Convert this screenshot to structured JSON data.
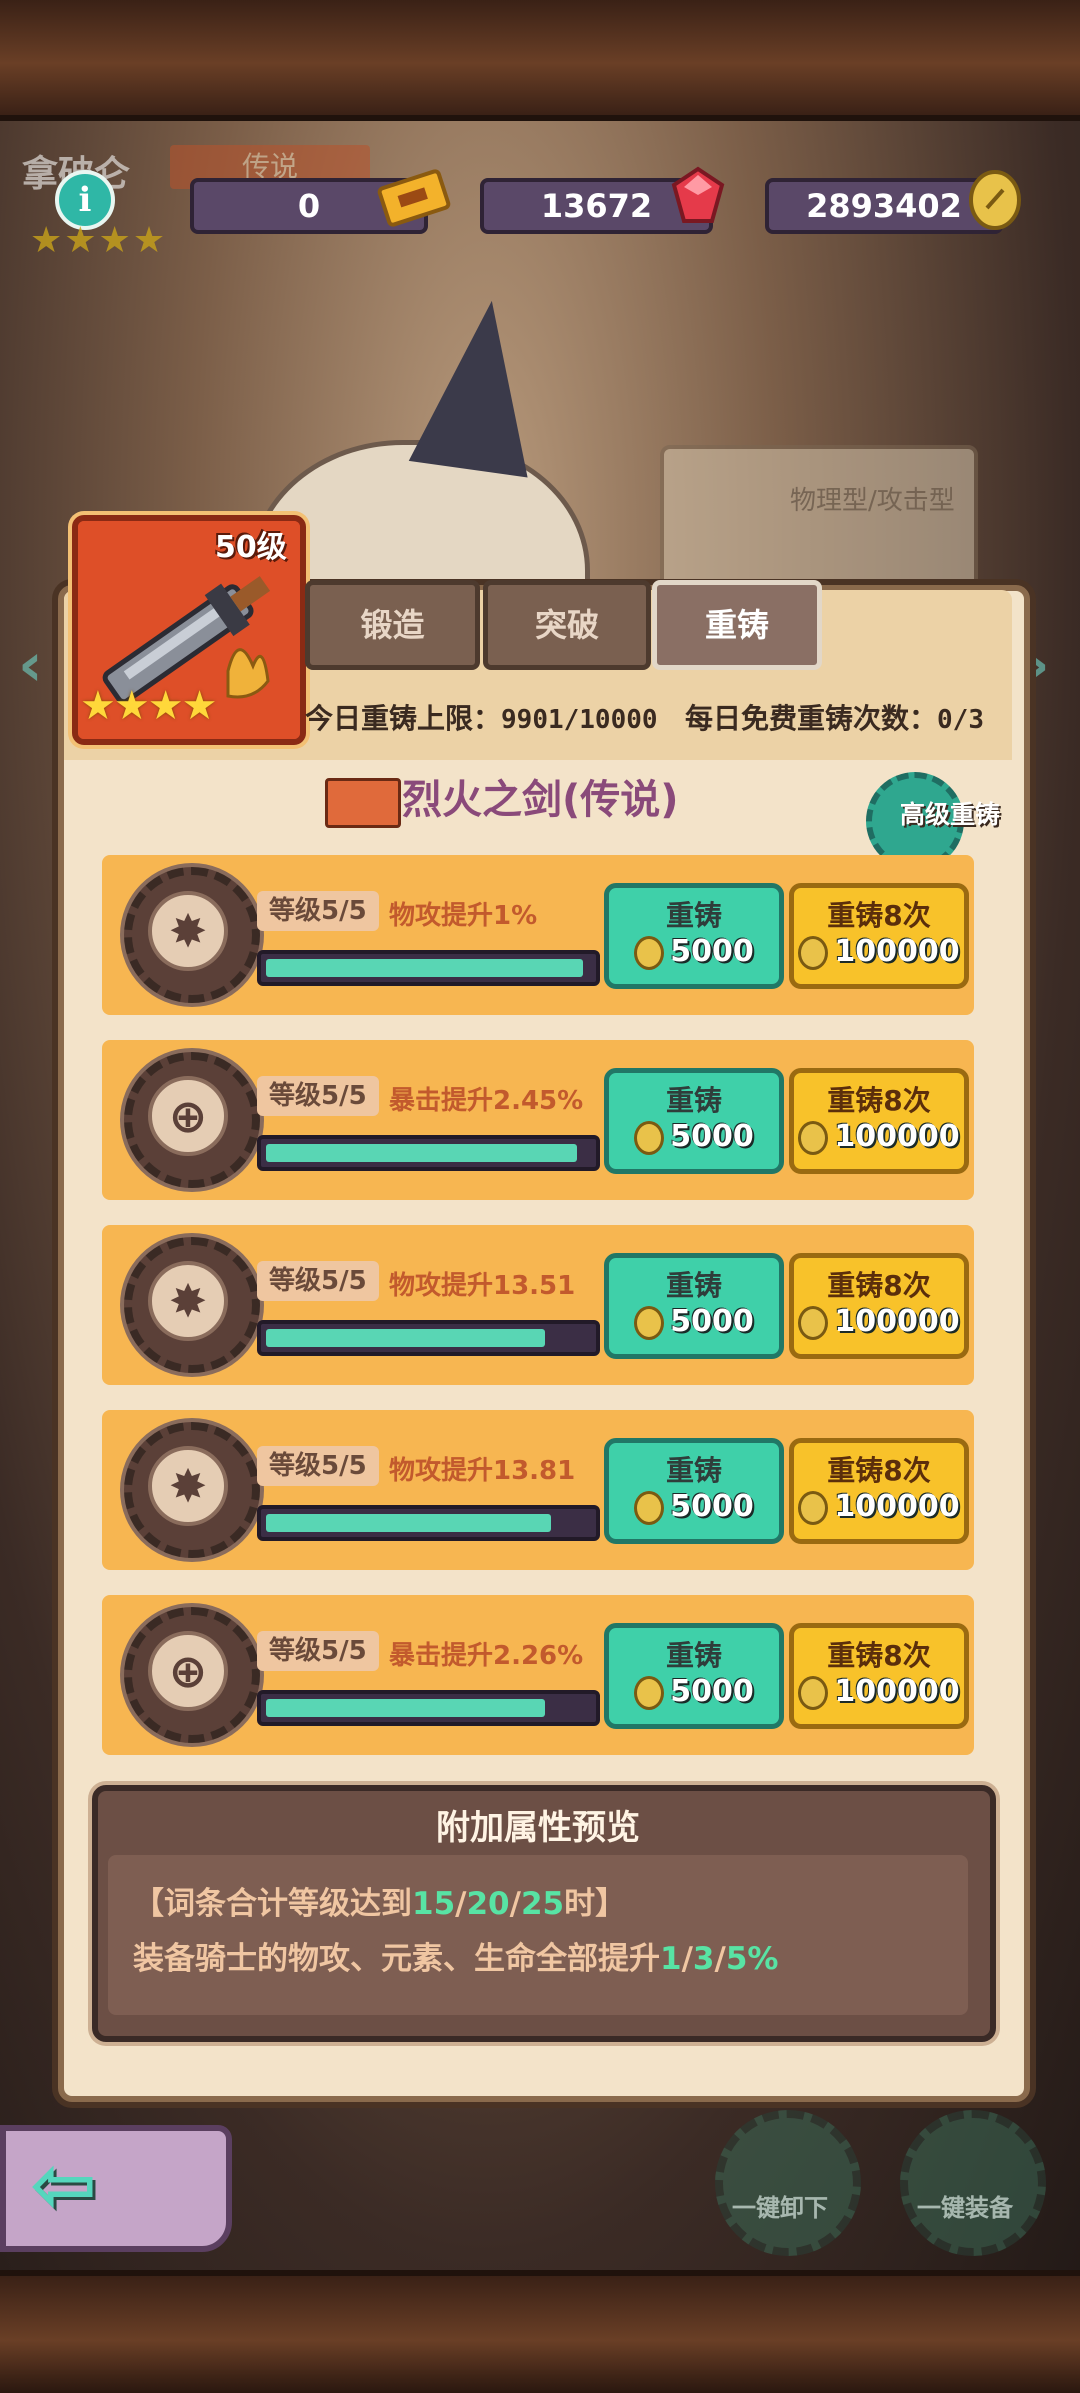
{
  "header": {
    "hero_name": "拿破仑",
    "rarity_tag": "传说",
    "info_icon": "i",
    "faded_stars": "★★★★",
    "currencies": [
      {
        "name": "ticket",
        "value": "0",
        "icon": "ticket-icon"
      },
      {
        "name": "gem",
        "value": "13672",
        "icon": "gem-icon"
      },
      {
        "name": "gold",
        "value": "2893402",
        "icon": "gold-coin-icon"
      }
    ]
  },
  "background": {
    "type_label": "物理型/攻击型"
  },
  "item": {
    "level": "50级",
    "stars": "★★★★",
    "name": "烈火之剑(传说)"
  },
  "tabs": [
    {
      "label": "锻造",
      "active": false
    },
    {
      "label": "突破",
      "active": false
    },
    {
      "label": "重铸",
      "active": true
    }
  ],
  "limits": {
    "daily_limit_label": "今日重铸上限：",
    "daily_limit_value": "9901/10000",
    "free_label": "每日免费重铸次数：",
    "free_value": "0/3"
  },
  "advanced_button": "高级重铸",
  "rows": [
    {
      "level": "等级5/5",
      "attr": "物攻提升1%",
      "progress": 1.0,
      "type": "attack",
      "btn1_label": "重铸",
      "btn1_cost": "5000",
      "btn2_label": "重铸8次",
      "btn2_cost": "100000"
    },
    {
      "level": "等级5/5",
      "attr": "暴击提升2.45%",
      "progress": 0.98,
      "type": "crit",
      "btn1_label": "重铸",
      "btn1_cost": "5000",
      "btn2_label": "重铸8次",
      "btn2_cost": "100000"
    },
    {
      "level": "等级5/5",
      "attr": "物攻提升13.51",
      "progress": 0.88,
      "type": "attack",
      "btn1_label": "重铸",
      "btn1_cost": "5000",
      "btn2_label": "重铸8次",
      "btn2_cost": "100000"
    },
    {
      "level": "等级5/5",
      "attr": "物攻提升13.81",
      "progress": 0.9,
      "type": "attack",
      "btn1_label": "重铸",
      "btn1_cost": "5000",
      "btn2_label": "重铸8次",
      "btn2_cost": "100000"
    },
    {
      "level": "等级5/5",
      "attr": "暴击提升2.26%",
      "progress": 0.88,
      "type": "crit",
      "btn1_label": "重铸",
      "btn1_cost": "5000",
      "btn2_label": "重铸8次",
      "btn2_cost": "100000"
    }
  ],
  "preview": {
    "title": "附加属性预览",
    "line1_prefix": "【词条合计等级达到",
    "line1_thresholds": [
      "15",
      "20",
      "25"
    ],
    "line1_suffix": "时】",
    "line2_prefix": "装备骑士的物攻、元素、生命全部提升",
    "line2_values": [
      "1",
      "3",
      "5%"
    ]
  },
  "footer": {
    "unequip_all": "一键卸下",
    "equip_all": "一键装备"
  },
  "colors": {
    "teal_button": "#3fd0a9",
    "gold_button": "#f8c22a",
    "highlight_green": "#58e3a4",
    "attribute_text": "#c25a2d"
  }
}
